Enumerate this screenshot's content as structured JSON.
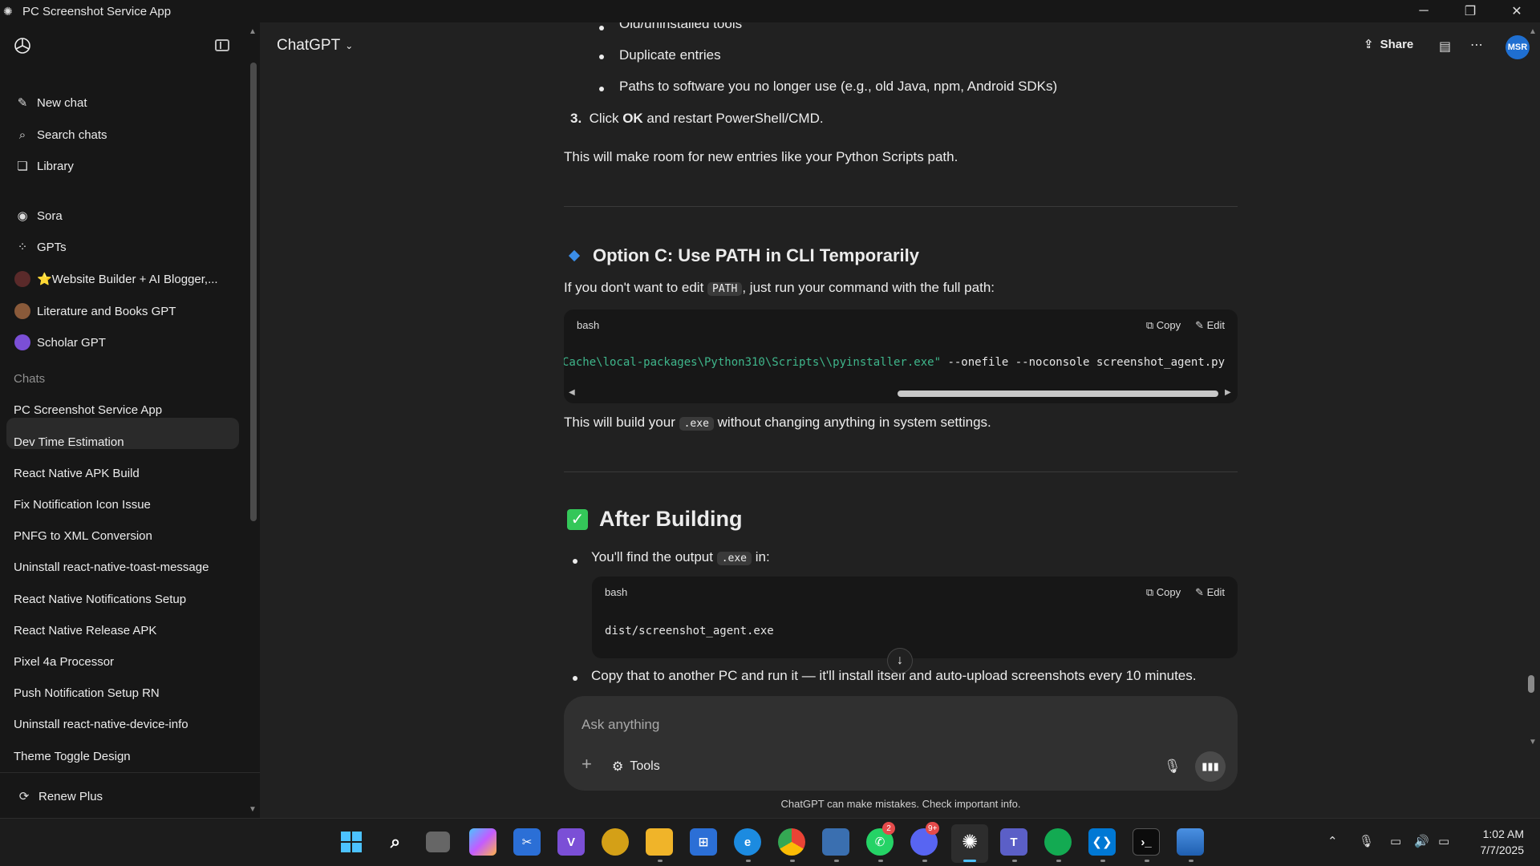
{
  "window": {
    "title": "PC Screenshot Service App",
    "controls": [
      "minimize",
      "restore",
      "close"
    ]
  },
  "sidebar": {
    "top_items": [
      {
        "label": "New chat",
        "icon": "new-chat-icon"
      },
      {
        "label": "Search chats",
        "icon": "search-icon"
      },
      {
        "label": "Library",
        "icon": "library-icon"
      }
    ],
    "gpt_items": [
      {
        "label": "Sora",
        "icon": "sora-icon"
      },
      {
        "label": "GPTs",
        "icon": "gpts-icon"
      },
      {
        "label": "⭐Website Builder + AI Blogger,...",
        "icon": "website-builder-avatar"
      },
      {
        "label": "Literature and Books GPT",
        "icon": "literature-avatar"
      },
      {
        "label": "Scholar GPT",
        "icon": "scholar-avatar"
      }
    ],
    "chats_heading": "Chats",
    "chats": [
      "PC Screenshot Service App",
      "Dev Time Estimation",
      "React Native APK Build",
      "Fix Notification Icon Issue",
      "PNFG to XML Conversion",
      "Uninstall react-native-toast-message",
      "React Native Notifications Setup",
      "React Native Release APK",
      "Pixel 4a Processor",
      "Push Notification Setup RN",
      "Uninstall react-native-device-info",
      "Theme Toggle Design"
    ],
    "active_chat": "PC Screenshot Service App",
    "footer": {
      "label": "Renew Plus",
      "icon": "renew-icon"
    }
  },
  "header": {
    "model": "ChatGPT",
    "share": "Share",
    "avatar": "MSR"
  },
  "content": {
    "list_top": [
      "Old/uninstalled tools",
      "Duplicate entries",
      "Paths to software you no longer use (e.g., old Java, npm, Android SDKs)"
    ],
    "step3_num": "3.",
    "step3_pre": "Click ",
    "step3_bold": "OK",
    "step3_post": " and restart PowerShell/CMD.",
    "room_text": "This will make room for new entries like your Python Scripts path.",
    "option_c_title": "Option C: Use PATH in CLI Temporarily",
    "option_c_pre": "If you don't want to edit ",
    "option_c_code": "PATH",
    "option_c_post": ", just run your command with the full path:",
    "code1": {
      "lang": "bash",
      "copy": "Copy",
      "edit": "Edit",
      "string_part": "Cache\\local-packages\\Python310\\Scripts\\\\pyinstaller.exe\"",
      "rest_part": " --onefile --noconsole screenshot_agent.py"
    },
    "build_pre": "This will build your ",
    "build_code": ".exe",
    "build_post": " without changing anything in system settings.",
    "after_title": "After Building",
    "find_pre": "You'll find the output ",
    "find_code": ".exe",
    "find_post": " in:",
    "code2": {
      "lang": "bash",
      "copy": "Copy",
      "edit": "Edit",
      "code": "dist/screenshot_agent.exe"
    },
    "copy_text": "Copy that to another PC and run it — it'll install itself and auto-upload screenshots every 10 minutes."
  },
  "composer": {
    "placeholder": "Ask anything",
    "tools": "Tools",
    "disclaimer": "ChatGPT can make mistakes. Check important info."
  },
  "taskbar": {
    "apps": [
      "start-icon",
      "search-icon",
      "task-view-icon",
      "copilot-icon",
      "snipping-icon",
      "visual-studio-icon",
      "chrome-canary-icon",
      "file-explorer-icon",
      "store-icon",
      "edge-icon",
      "chrome-icon",
      "remote-desktop-icon",
      "whatsapp-icon",
      "discord-icon",
      "chatgpt-icon",
      "teams-icon",
      "mongodb-icon",
      "vscode-icon",
      "terminal-icon",
      "photos-icon"
    ],
    "whatsapp_badge": "2",
    "discord_badge": "9+",
    "time": "1:02 AM",
    "date": "7/7/2025"
  }
}
